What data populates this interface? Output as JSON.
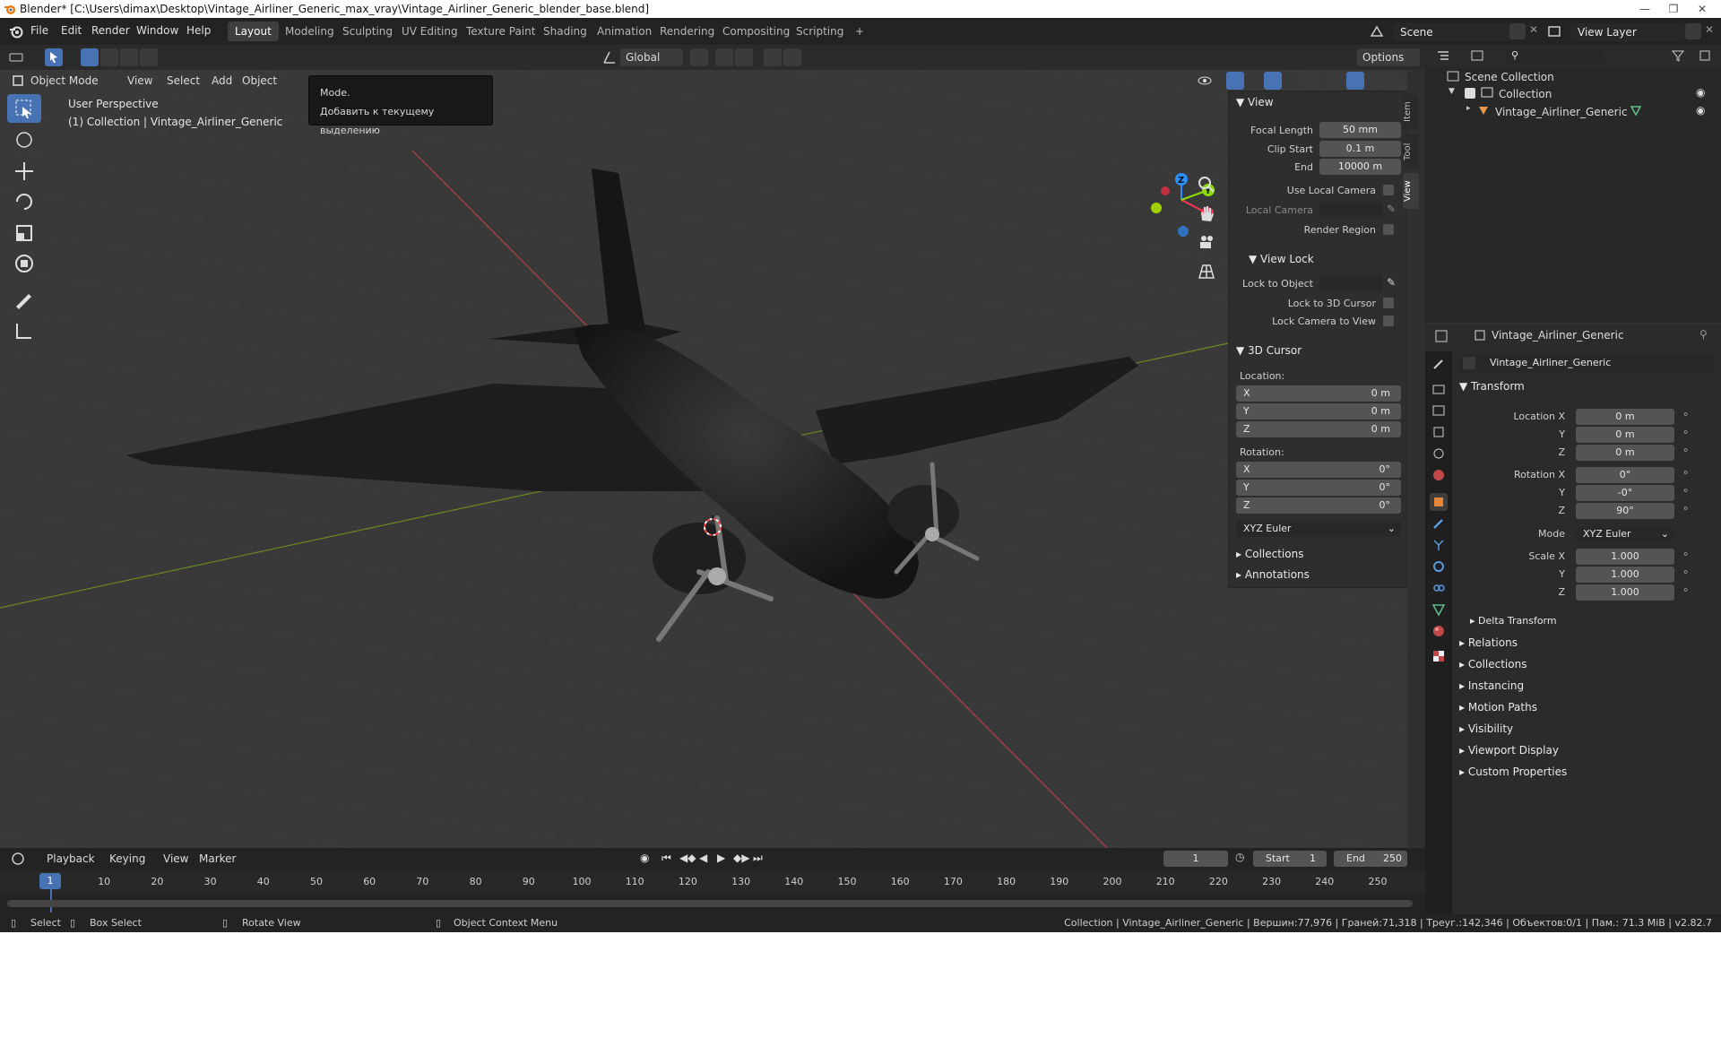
{
  "window": {
    "title": "Blender* [C:\\Users\\dimax\\Desktop\\Vintage_Airliner_Generic_max_vray\\Vintage_Airliner_Generic_blender_base.blend]"
  },
  "menu": [
    "File",
    "Edit",
    "Render",
    "Window",
    "Help"
  ],
  "workspaces": [
    "Layout",
    "Modeling",
    "Sculpting",
    "UV Editing",
    "Texture Paint",
    "Shading",
    "Animation",
    "Rendering",
    "Compositing",
    "Scripting",
    "+"
  ],
  "top_right": {
    "scene": "Scene",
    "view_layer": "View Layer"
  },
  "viewport_header": {
    "mode": "Object Mode",
    "menus": [
      "View",
      "Select",
      "Add",
      "Object"
    ],
    "transform_orientation": "Global",
    "options": "Options"
  },
  "viewport": {
    "perspective": "User Perspective",
    "collection_label": "(1) Collection | Vintage_Airliner_Generic",
    "gizmo_axes": [
      "X",
      "Y",
      "Z"
    ]
  },
  "tooltip": {
    "title": "Mode.",
    "body": "Добавить к текущему выделению"
  },
  "npanel": {
    "tabs": [
      "Item",
      "Tool",
      "View"
    ],
    "view": {
      "title": "View",
      "focal_length_label": "Focal Length",
      "focal_length": "50 mm",
      "clip_start_label": "Clip Start",
      "clip_start": "0.1 m",
      "end_label": "End",
      "end": "10000 m",
      "use_local_camera": "Use Local Camera",
      "local_camera": "Local Camera",
      "render_region": "Render Region"
    },
    "view_lock": {
      "title": "View Lock",
      "lock_to_object": "Lock to Object",
      "lock_to_3d_cursor": "Lock to 3D Cursor",
      "lock_camera_to_view": "Lock Camera to View"
    },
    "cursor": {
      "title": "3D Cursor",
      "location_label": "Location:",
      "location": [
        {
          "axis": "X",
          "value": "0 m"
        },
        {
          "axis": "Y",
          "value": "0 m"
        },
        {
          "axis": "Z",
          "value": "0 m"
        }
      ],
      "rotation_label": "Rotation:",
      "rotation": [
        {
          "axis": "X",
          "value": "0°"
        },
        {
          "axis": "Y",
          "value": "0°"
        },
        {
          "axis": "Z",
          "value": "0°"
        }
      ],
      "rotation_mode": "XYZ Euler"
    },
    "collections": "Collections",
    "annotations": "Annotations"
  },
  "outliner": {
    "scene_collection": "Scene Collection",
    "collection": "Collection",
    "object": "Vintage_Airliner_Generic"
  },
  "properties": {
    "object_name": "Vintage_Airliner_Generic",
    "datablock": "Vintage_Airliner_Generic",
    "transform": {
      "title": "Transform",
      "location_x_label": "Location X",
      "location": [
        "0 m",
        "0 m",
        "0 m"
      ],
      "rotation_x_label": "Rotation X",
      "rotation": [
        "0°",
        "-0°",
        "90°"
      ],
      "mode_label": "Mode",
      "mode": "XYZ Euler",
      "scale_x_label": "Scale X",
      "scale": [
        "1.000",
        "1.000",
        "1.000"
      ],
      "y_label": "Y",
      "z_label": "Z"
    },
    "delta_transform": "Delta Transform",
    "sections": [
      "Relations",
      "Collections",
      "Instancing",
      "Motion Paths",
      "Visibility",
      "Viewport Display",
      "Custom Properties"
    ]
  },
  "timeline": {
    "menus": [
      "Playback",
      "Keying",
      "View",
      "Marker"
    ],
    "current_frame": "1",
    "start_label": "Start",
    "start": "1",
    "end_label": "End",
    "end": "250",
    "ticks": [
      "10",
      "20",
      "30",
      "40",
      "50",
      "60",
      "70",
      "80",
      "90",
      "100",
      "110",
      "120",
      "130",
      "140",
      "150",
      "160",
      "170",
      "180",
      "190",
      "200",
      "210",
      "220",
      "230",
      "240",
      "250"
    ],
    "playhead": "1"
  },
  "statusbar": {
    "select": "Select",
    "box_select": "Box Select",
    "rotate_view": "Rotate View",
    "context_menu": "Object Context Menu",
    "stats": "Collection | Vintage_Airliner_Generic | Вершин:77,976 | Граней:71,318 | Треуг.:142,346 | Объектов:0/1 | Пам.: 71.3 MiB | v2.82.7"
  },
  "colors": {
    "accent": "#4772b3",
    "axis_x": "#ff3352",
    "axis_y": "#8bdc00",
    "axis_z": "#2890ff"
  }
}
